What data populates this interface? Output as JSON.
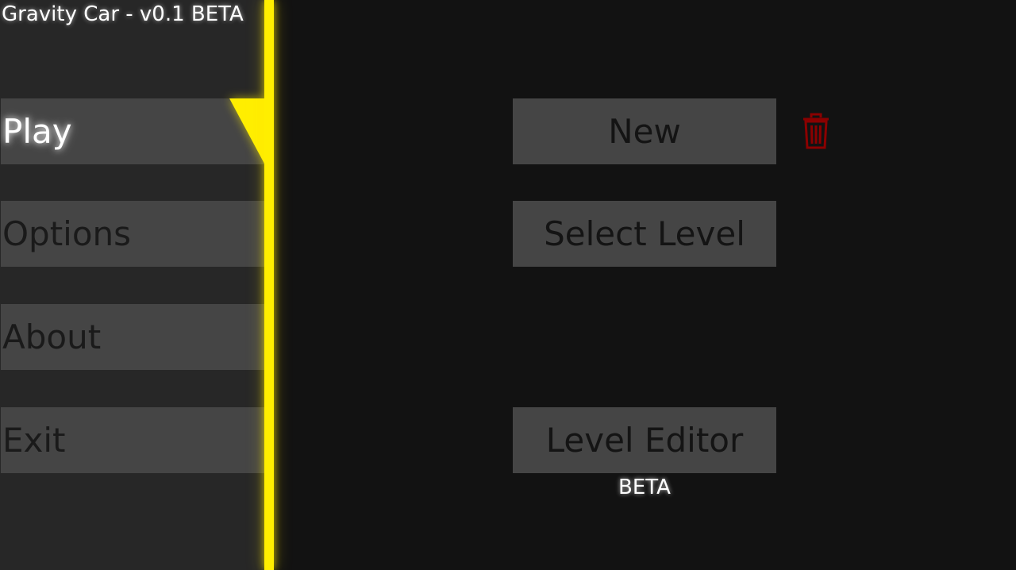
{
  "app": {
    "title": "Gravity Car - v0.1 BETA"
  },
  "menu": {
    "items": [
      {
        "label": "Play",
        "active": true
      },
      {
        "label": "Options",
        "active": false
      },
      {
        "label": "About",
        "active": false
      },
      {
        "label": "Exit",
        "active": false
      }
    ]
  },
  "play_panel": {
    "new_label": "New",
    "select_level_label": "Select Level",
    "level_editor_label": "Level Editor",
    "level_editor_badge": "BETA",
    "delete_icon": "trash-icon"
  },
  "colors": {
    "accent": "#ffee00",
    "delete": "#8b0000",
    "button_bg": "#454545",
    "sidebar_bg": "#272727",
    "background": "#121212"
  }
}
